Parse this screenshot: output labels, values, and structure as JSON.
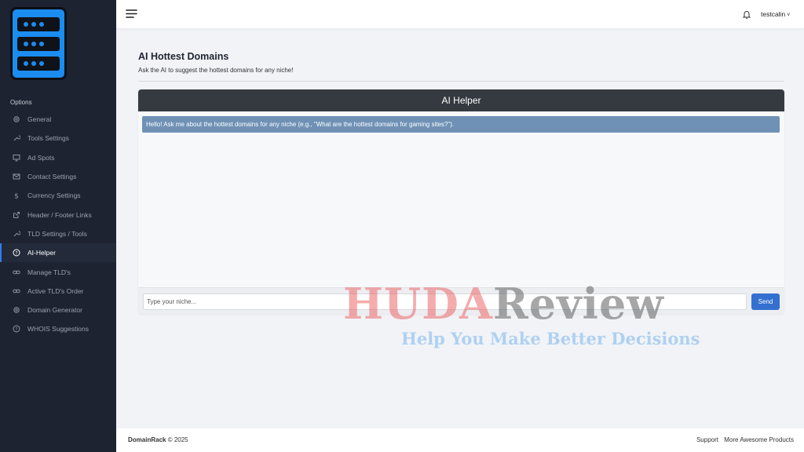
{
  "sidebar": {
    "section_title": "Options",
    "items": [
      {
        "label": "General",
        "icon": "gear-icon"
      },
      {
        "label": "Tools Settings",
        "icon": "wrench-icon"
      },
      {
        "label": "Ad Spots",
        "icon": "monitor-icon"
      },
      {
        "label": "Contact Settings",
        "icon": "envelope-icon"
      },
      {
        "label": "Currency Settings",
        "icon": "dollar-icon"
      },
      {
        "label": "Header / Footer Links",
        "icon": "external-link-icon"
      },
      {
        "label": "TLD Settings / Tools",
        "icon": "wrench-icon"
      },
      {
        "label": "AI-Helper",
        "icon": "question-circle-icon",
        "active": true
      },
      {
        "label": "Manage TLD's",
        "icon": "link-icon"
      },
      {
        "label": "Active TLD's Order",
        "icon": "link-icon"
      },
      {
        "label": "Domain Generator",
        "icon": "gear-icon"
      },
      {
        "label": "WHOIS Suggestions",
        "icon": "question-circle-icon"
      }
    ]
  },
  "topbar": {
    "username": "testcalin",
    "caret": "˅"
  },
  "main": {
    "title": "AI Hottest Domains",
    "subtitle": "Ask the AI to suggest the hottest domains for any niche!",
    "chat": {
      "header": "AI Helper",
      "bot_message": "Hello! Ask me about the hottest domains for any niche (e.g., \"What are the hottest domains for gaming sites?\").",
      "input_placeholder": "Type your niche...",
      "send_label": "Send"
    }
  },
  "watermark": {
    "part1": "HUDA",
    "part2": "Review",
    "tagline": "Help You Make Better Decisions"
  },
  "footer": {
    "brand": "DomainRack",
    "copyright": "© 2025",
    "links": [
      "Support",
      "More Awesome Products"
    ]
  },
  "colors": {
    "sidebar_bg": "#1d2330",
    "accent": "#2f7cf6",
    "chat_header": "#343a40",
    "bot_bubble": "#6f91b5",
    "send_button": "#3370cf"
  }
}
